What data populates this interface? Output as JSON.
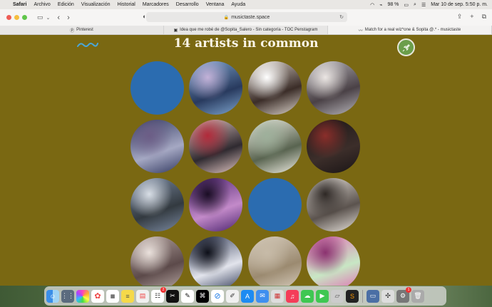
{
  "menubar": {
    "app": "Safari",
    "items": [
      "Archivo",
      "Edición",
      "Visualización",
      "Historial",
      "Marcadores",
      "Desarrollo",
      "Ventana",
      "Ayuda"
    ],
    "battery": "98 %",
    "clock": "Mar 10 de sep.  5:50 p. m."
  },
  "toolbar": {
    "url": "musictaste.space"
  },
  "tabs": [
    {
      "label": "Pinterest",
      "icon": "pinterest-icon"
    },
    {
      "label": "Idea que me robé de @Sopita_Salero - Sin categoría - TOC Penstagram",
      "icon": "page-icon"
    },
    {
      "label": "Match for a real wiz*one & Sopita @.* - musictaste",
      "icon": "wave-icon"
    }
  ],
  "page": {
    "title": "14 artists in common",
    "artists": [
      {
        "colors": [
          "#2b6cb0",
          "#2b6cb0",
          "#2b6cb0"
        ]
      },
      {
        "colors": [
          "#7fa6cf",
          "#283a5e",
          "#c3b2d8"
        ]
      },
      {
        "colors": [
          "#ddd5cd",
          "#3b2d28",
          "#ffffff"
        ]
      },
      {
        "colors": [
          "#b8b6bb",
          "#4a4146",
          "#ebe6e3"
        ]
      },
      {
        "colors": [
          "#31385f",
          "#a5a8c3",
          "#6c5d86"
        ]
      },
      {
        "colors": [
          "#e3c7c4",
          "#2f2a30",
          "#b22a3a"
        ]
      },
      {
        "colors": [
          "#f0eee4",
          "#596450",
          "#9eb09b"
        ]
      },
      {
        "colors": [
          "#1a1516",
          "#3c2e2a",
          "#8a2e2a"
        ]
      },
      {
        "colors": [
          "#7b8aa2",
          "#333a40",
          "#d8dee6"
        ]
      },
      {
        "colors": [
          "#4a236e",
          "#c38ac9",
          "#1a0d24"
        ]
      },
      {
        "colors": [
          "#2b6cb0",
          "#2b6cb0",
          "#2b6cb0"
        ]
      },
      {
        "colors": [
          "#e7e2dc",
          "#5b534e",
          "#2e2825"
        ]
      },
      {
        "colors": [
          "#b7a7a3",
          "#5c4a4a",
          "#eae1dc"
        ]
      },
      {
        "colors": [
          "#313a56",
          "#e2e4ec",
          "#0d0f18"
        ]
      },
      {
        "colors": [
          "#d9cfc0",
          "#9b8a70",
          "#c7bba8"
        ]
      },
      {
        "colors": [
          "#e06fb4",
          "#c8e7c4",
          "#8b3270"
        ]
      }
    ]
  },
  "dock": {
    "badges": {
      "reminders": "2",
      "settings": "1"
    }
  }
}
